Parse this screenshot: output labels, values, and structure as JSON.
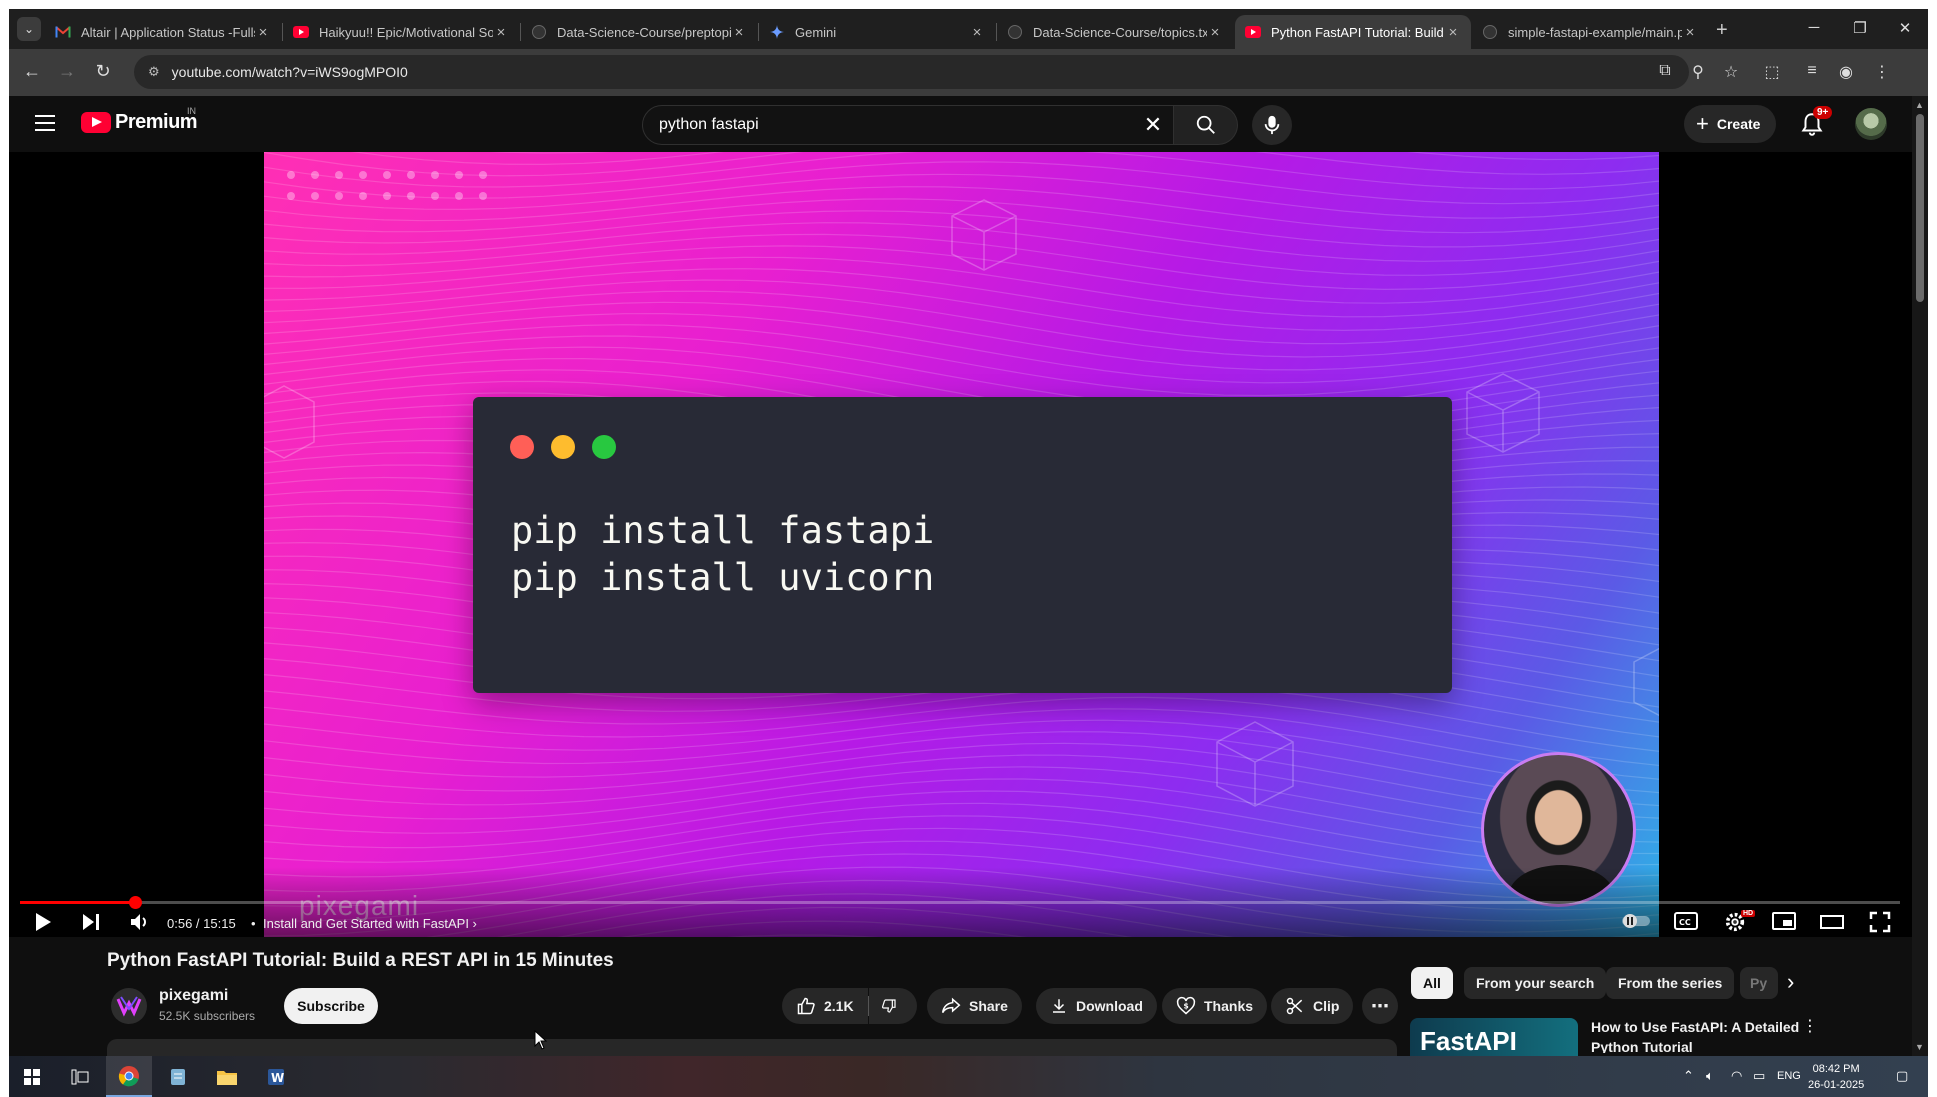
{
  "browser": {
    "tabs": [
      {
        "title": "Altair | Application Status -Fulls",
        "favicon": "gmail-icon",
        "active": false
      },
      {
        "title": "Haikyuu!! Epic/Motivational So",
        "favicon": "youtube-icon",
        "active": false
      },
      {
        "title": "Data-Science-Course/preptopic",
        "favicon": "github-icon",
        "active": false
      },
      {
        "title": "Gemini",
        "favicon": "gemini-icon",
        "active": false
      },
      {
        "title": "Data-Science-Course/topics.txt",
        "favicon": "github-icon",
        "active": false
      },
      {
        "title": "Python FastAPI Tutorial: Build a",
        "favicon": "youtube-icon",
        "active": true
      },
      {
        "title": "simple-fastapi-example/main.p",
        "favicon": "github-icon",
        "active": false
      }
    ],
    "url": "youtube.com/watch?v=iWS9ogMPOI0"
  },
  "youtube": {
    "logo_text": "Premium",
    "country_code": "IN",
    "search_query": "python fastapi",
    "create_label": "Create",
    "notification_count": "9+",
    "video": {
      "code_lines": "pip install fastapi\npip install uvicorn",
      "watermark": "pixegami",
      "time": "0:56 / 15:15",
      "chapter": "Install and Get Started with FastAPI",
      "progress_fraction": 0.061,
      "hd_badge": "HD"
    },
    "title": "Python FastAPI Tutorial: Build a REST API in 15 Minutes",
    "channel": {
      "name": "pixegami",
      "subscribers": "52.5K subscribers"
    },
    "subscribe_label": "Subscribe",
    "actions": {
      "likes": "2.1K",
      "share": "Share",
      "download": "Download",
      "thanks": "Thanks",
      "clip": "Clip"
    },
    "chips": [
      "All",
      "From your search",
      "From the series",
      "Py"
    ],
    "recommendation": {
      "thumb_text": "FastAPI",
      "title": "How to Use FastAPI: A Detailed Python Tutorial"
    }
  },
  "taskbar": {
    "language": "ENG",
    "time": "08:42 PM",
    "date": "26-01-2025"
  },
  "colors": {
    "accent_red": "#ff0000",
    "youtube_red": "#ff0033",
    "page_bg": "#0f0f0f"
  }
}
